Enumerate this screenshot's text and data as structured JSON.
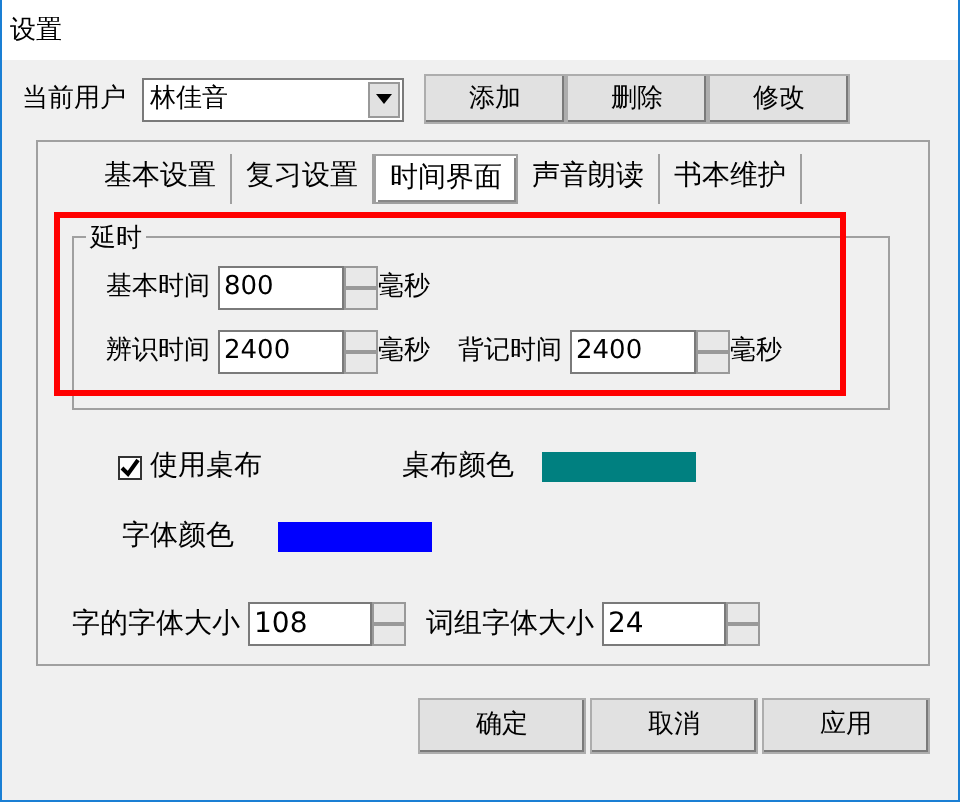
{
  "window": {
    "title": "设置"
  },
  "user": {
    "label": "当前用户",
    "value": "林佳音",
    "buttons": [
      "添加",
      "删除",
      "修改"
    ]
  },
  "tabs": [
    {
      "label": "基本设置",
      "selected": false
    },
    {
      "label": "复习设置",
      "selected": false
    },
    {
      "label": "时间界面",
      "selected": true
    },
    {
      "label": "声音朗读",
      "selected": false
    },
    {
      "label": "书本维护",
      "selected": false
    }
  ],
  "delay": {
    "title": "延时",
    "highlighted": true,
    "rows": [
      [
        {
          "label": "基本时间",
          "value": "800",
          "unit": "毫秒"
        }
      ],
      [
        {
          "label": "辨识时间",
          "value": "2400",
          "unit": "毫秒"
        },
        {
          "label": "背记时间",
          "value": "2400",
          "unit": "毫秒"
        }
      ]
    ]
  },
  "use_tablecloth": {
    "label": "使用桌布",
    "checked": true
  },
  "colors": [
    {
      "label": "桌布颜色",
      "color": "#008080"
    },
    {
      "label": "字体颜色",
      "color": "#0000ff"
    }
  ],
  "sizes": [
    {
      "label": "字的字体大小",
      "value": "108"
    },
    {
      "label": "词组字体大小",
      "value": "24"
    }
  ],
  "buttons": [
    "确定",
    "取消",
    "应用"
  ]
}
